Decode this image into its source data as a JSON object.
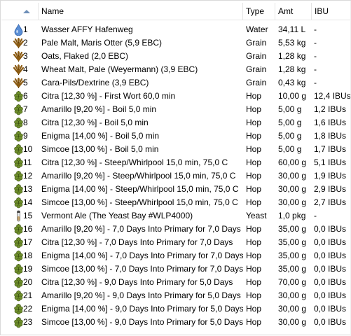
{
  "columns": {
    "name": "Name",
    "type": "Type",
    "amt": "Amt",
    "ibu": "IBU"
  },
  "rows": [
    {
      "num": "1",
      "icon": "water-drop-icon",
      "name": "Wasser AFFY Hafenweg",
      "type": "Water",
      "amt": "34,11 L",
      "ibu": "-"
    },
    {
      "num": "2",
      "icon": "grain-icon",
      "name": "Pale Malt, Maris Otter (5,9 EBC)",
      "type": "Grain",
      "amt": "5,53 kg",
      "ibu": "-"
    },
    {
      "num": "3",
      "icon": "grain-icon",
      "name": "Oats, Flaked (2,0 EBC)",
      "type": "Grain",
      "amt": "1,28 kg",
      "ibu": "-"
    },
    {
      "num": "4",
      "icon": "grain-icon",
      "name": "Wheat Malt, Pale (Weyermann) (3,9 EBC)",
      "type": "Grain",
      "amt": "1,28 kg",
      "ibu": "-"
    },
    {
      "num": "5",
      "icon": "grain-icon",
      "name": "Cara-Pils/Dextrine (3,9 EBC)",
      "type": "Grain",
      "amt": "0,43 kg",
      "ibu": "-"
    },
    {
      "num": "6",
      "icon": "hop-icon",
      "name": "Citra [12,30 %] - First Wort 60,0 min",
      "type": "Hop",
      "amt": "10,00 g",
      "ibu": "12,4 IBUs"
    },
    {
      "num": "7",
      "icon": "hop-icon",
      "name": "Amarillo [9,20 %] - Boil 5,0 min",
      "type": "Hop",
      "amt": "5,00 g",
      "ibu": "1,2 IBUs"
    },
    {
      "num": "8",
      "icon": "hop-icon",
      "name": "Citra [12,30 %] - Boil 5,0 min",
      "type": "Hop",
      "amt": "5,00 g",
      "ibu": "1,6 IBUs"
    },
    {
      "num": "9",
      "icon": "hop-icon",
      "name": "Enigma [14,00 %] - Boil 5,0 min",
      "type": "Hop",
      "amt": "5,00 g",
      "ibu": "1,8 IBUs"
    },
    {
      "num": "10",
      "icon": "hop-icon",
      "name": "Simcoe [13,00 %] - Boil 5,0 min",
      "type": "Hop",
      "amt": "5,00 g",
      "ibu": "1,7 IBUs"
    },
    {
      "num": "11",
      "icon": "hop-icon",
      "name": "Citra [12,30 %] - Steep/Whirlpool  15,0 min, 75,0 C",
      "type": "Hop",
      "amt": "60,00 g",
      "ibu": "5,1 IBUs"
    },
    {
      "num": "12",
      "icon": "hop-icon",
      "name": "Amarillo [9,20 %] - Steep/Whirlpool  15,0 min, 75,0 C",
      "type": "Hop",
      "amt": "30,00 g",
      "ibu": "1,9 IBUs"
    },
    {
      "num": "13",
      "icon": "hop-icon",
      "name": "Enigma [14,00 %] - Steep/Whirlpool  15,0 min, 75,0 C",
      "type": "Hop",
      "amt": "30,00 g",
      "ibu": "2,9 IBUs"
    },
    {
      "num": "14",
      "icon": "hop-icon",
      "name": "Simcoe [13,00 %] - Steep/Whirlpool  15,0 min, 75,0 C",
      "type": "Hop",
      "amt": "30,00 g",
      "ibu": "2,7 IBUs"
    },
    {
      "num": "15",
      "icon": "yeast-vial-icon",
      "name": "Vermont Ale (The Yeast Bay #WLP4000)",
      "type": "Yeast",
      "amt": "1,0 pkg",
      "ibu": "-"
    },
    {
      "num": "16",
      "icon": "hop-icon",
      "name": "Amarillo [9,20 %] - 7,0 Days Into Primary for 7,0 Days",
      "type": "Hop",
      "amt": "35,00 g",
      "ibu": "0,0 IBUs"
    },
    {
      "num": "17",
      "icon": "hop-icon",
      "name": "Citra [12,30 %] - 7,0 Days Into Primary for 7,0 Days",
      "type": "Hop",
      "amt": "35,00 g",
      "ibu": "0,0 IBUs"
    },
    {
      "num": "18",
      "icon": "hop-icon",
      "name": "Enigma [14,00 %] - 7,0 Days Into Primary for 7,0 Days",
      "type": "Hop",
      "amt": "35,00 g",
      "ibu": "0,0 IBUs"
    },
    {
      "num": "19",
      "icon": "hop-icon",
      "name": "Simcoe [13,00 %] - 7,0 Days Into Primary for 7,0 Days",
      "type": "Hop",
      "amt": "35,00 g",
      "ibu": "0,0 IBUs"
    },
    {
      "num": "20",
      "icon": "hop-icon",
      "name": "Citra [12,30 %] - 9,0 Days Into Primary for 5,0 Days",
      "type": "Hop",
      "amt": "70,00 g",
      "ibu": "0,0 IBUs"
    },
    {
      "num": "21",
      "icon": "hop-icon",
      "name": "Amarillo [9,20 %] - 9,0 Days Into Primary for 5,0 Days",
      "type": "Hop",
      "amt": "30,00 g",
      "ibu": "0,0 IBUs"
    },
    {
      "num": "22",
      "icon": "hop-icon",
      "name": "Enigma [14,00 %] - 9,0 Days Into Primary for 5,0 Days",
      "type": "Hop",
      "amt": "30,00 g",
      "ibu": "0,0 IBUs"
    },
    {
      "num": "23",
      "icon": "hop-icon",
      "name": "Simcoe [13,00 %] - 9,0 Days Into Primary for 5,0 Days",
      "type": "Hop",
      "amt": "30,00 g",
      "ibu": "0,0 IBUs"
    }
  ],
  "colors": {
    "hop": "#6f8f2c",
    "grain": "#8a5a12",
    "water": "#5b8fd6",
    "sort_arrow": "#6e8fb8"
  }
}
